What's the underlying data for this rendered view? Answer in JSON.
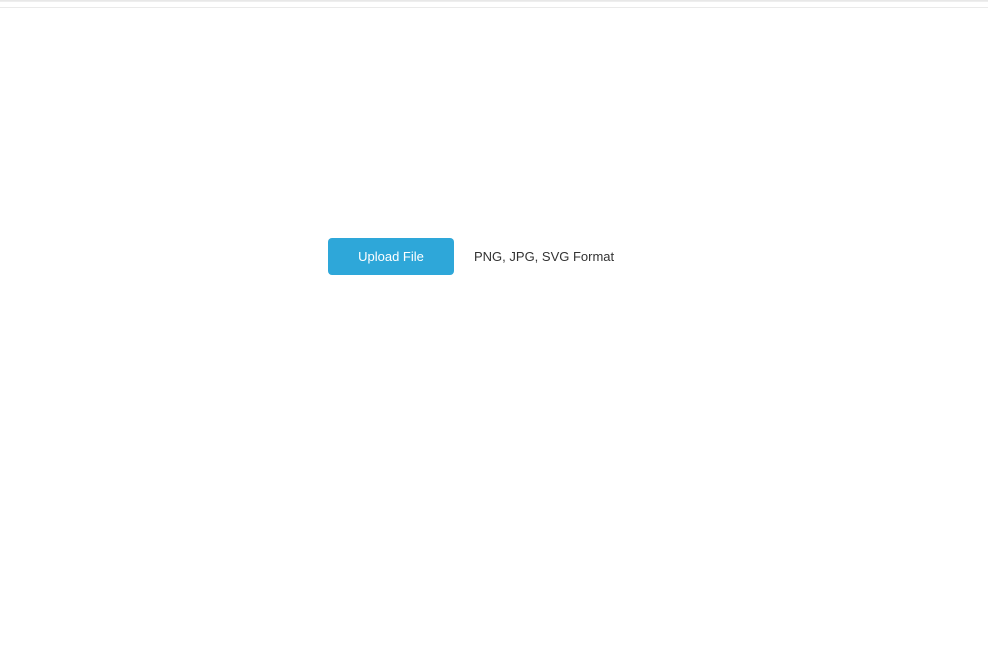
{
  "upload": {
    "button_label": "Upload File",
    "format_hint": "PNG, JPG, SVG Format"
  }
}
